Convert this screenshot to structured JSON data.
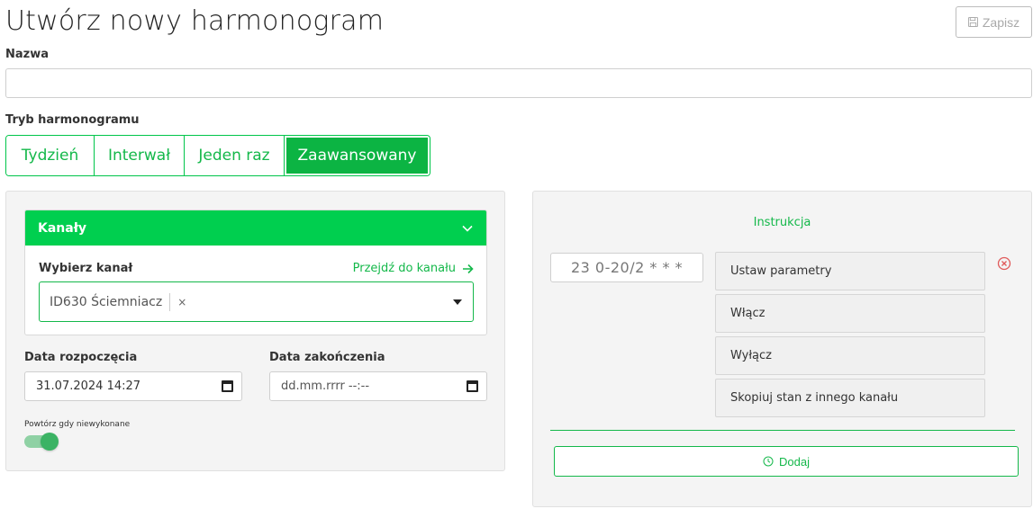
{
  "header": {
    "title": "Utwórz nowy harmonogram",
    "save_label": "Zapisz",
    "save_icon": "floppy-disk-icon"
  },
  "form": {
    "name_label": "Nazwa",
    "name_value": "",
    "mode_label": "Tryb harmonogramu",
    "modes": [
      {
        "label": "Tydzień",
        "active": false
      },
      {
        "label": "Interwał",
        "active": false
      },
      {
        "label": "Jeden raz",
        "active": false
      },
      {
        "label": "Zaawansowany",
        "active": true
      }
    ]
  },
  "channels": {
    "header": "Kanały",
    "select_label": "Wybierz kanał",
    "goto_link": "Przejdź do kanału",
    "selected": "ID630 Ściemniacz",
    "remove_symbol": "×"
  },
  "dates": {
    "start_label": "Data rozpoczęcia",
    "start_value": "31.07.2024 14:27",
    "end_label": "Data zakończenia",
    "end_value": "dd.mm.rrrr --:--"
  },
  "repeat": {
    "label": "Powtórz gdy niewykonane",
    "enabled": true
  },
  "instructions": {
    "title": "Instrukcja",
    "cron": "23 0-20/2 * * *",
    "actions": [
      "Ustaw parametry",
      "Włącz",
      "Wyłącz",
      "Skopiuj stan z innego kanału"
    ],
    "add_label": "Dodaj",
    "add_icon": "clock-icon"
  },
  "colors": {
    "accent": "#00cf4f",
    "accent_dark": "#0cb443",
    "remove": "#e05a5a"
  }
}
